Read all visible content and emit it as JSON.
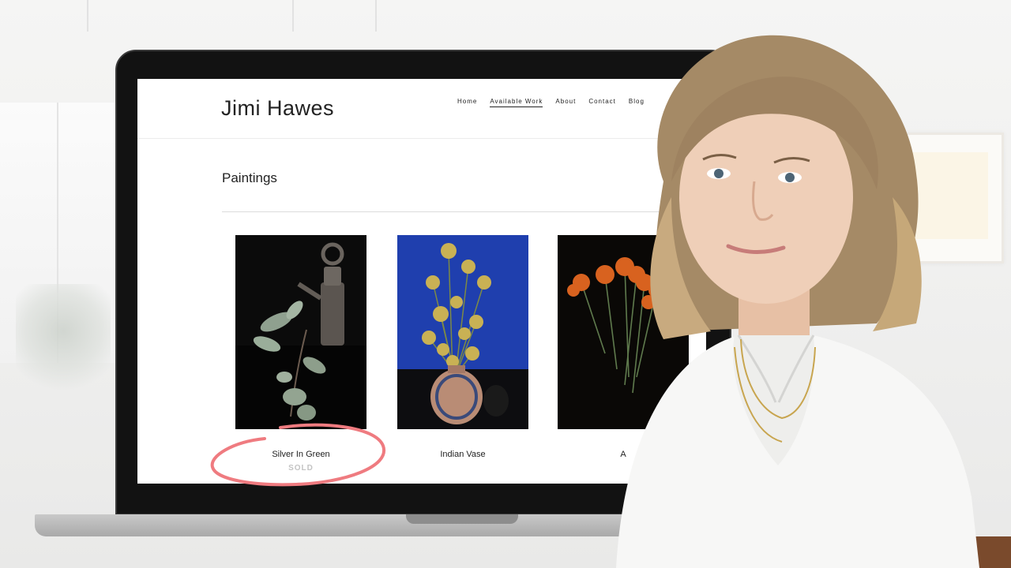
{
  "site": {
    "title": "Jimi Hawes",
    "nav": [
      "Home",
      "Available Work",
      "About",
      "Contact",
      "Blog"
    ],
    "active_nav": "Available Work"
  },
  "page": {
    "heading": "Paintings",
    "artworks": [
      {
        "title": "Silver In Green",
        "status": "SOLD"
      },
      {
        "title": "Indian Vase",
        "status": ""
      },
      {
        "title": "A",
        "status": ""
      }
    ]
  },
  "colors": {
    "annotation": "#ef7b80",
    "indian_vase_blue": "#1f3fae"
  }
}
